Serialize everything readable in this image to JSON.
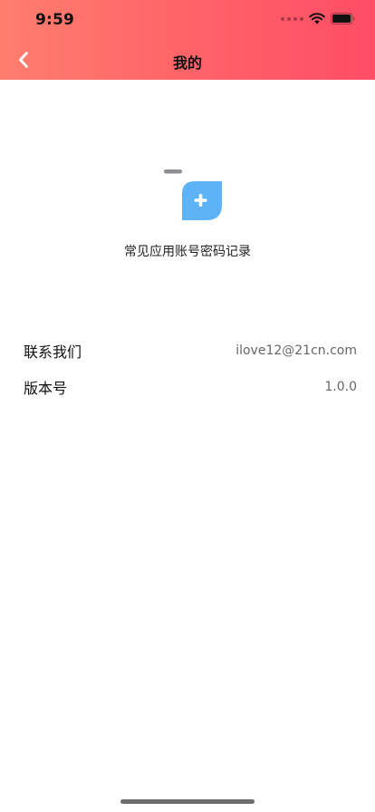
{
  "status_bar": {
    "time": "9:59",
    "icons": [
      "signal-dots-icon",
      "wifi-icon",
      "battery-icon"
    ]
  },
  "nav": {
    "title": "我的",
    "back_icon": "chevron-left-icon"
  },
  "app": {
    "name": "常见应用账号密码记录",
    "logo_icon": "plus-leaf-icon"
  },
  "info": {
    "contact_label": "联系我们",
    "contact_value": "ilove12@21cn.com",
    "version_label": "版本号",
    "version_value": "1.0.0"
  },
  "colors": {
    "header_start": "#ff7e6e",
    "header_end": "#ff4d66",
    "logo_blue": "#5eb3f6"
  }
}
